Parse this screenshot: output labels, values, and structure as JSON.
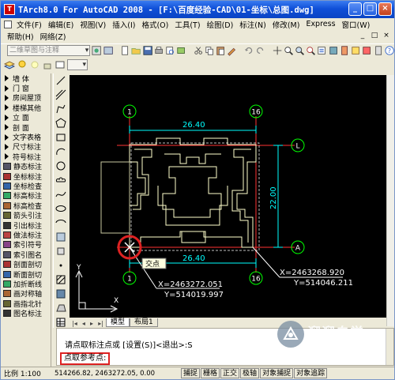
{
  "window": {
    "title": "TArch8.0 For AutoCAD 2008 - [F:\\百度经验-CAD\\01-坐标\\总图.dwg]",
    "app_icon_label": "T",
    "minimize": "_",
    "maximize": "□",
    "close": "×"
  },
  "menu": {
    "row1": [
      "文件(F)",
      "编辑(E)",
      "视图(V)",
      "插入(I)",
      "格式(O)",
      "工具(T)",
      "绘图(D)",
      "标注(N)",
      "修改(M)",
      "Express",
      "窗口(W)"
    ],
    "row2": [
      "帮助(H)",
      "网络(Z)"
    ],
    "mdi_buttons": [
      "_",
      "□",
      "×"
    ]
  },
  "toolbar": {
    "workspace_combo": "二维草图与注释"
  },
  "left_panel": {
    "items": [
      {
        "label": "墙    体",
        "sub": false
      },
      {
        "label": "门    窗",
        "sub": false
      },
      {
        "label": "房间屋顶",
        "sub": false
      },
      {
        "label": "楼梯其他",
        "sub": false
      },
      {
        "label": "立    面",
        "sub": false
      },
      {
        "label": "剖    面",
        "sub": false
      },
      {
        "label": "文字表格",
        "sub": false
      },
      {
        "label": "尺寸标注",
        "sub": false
      },
      {
        "label": "符号标注",
        "sub": false
      },
      {
        "label": "静态标注",
        "sub": true
      },
      {
        "label": "坐标标注",
        "sub": true
      },
      {
        "label": "坐标检查",
        "sub": true
      },
      {
        "label": "标高标注",
        "sub": true
      },
      {
        "label": "标高检查",
        "sub": true
      },
      {
        "label": "箭头引注",
        "sub": true
      },
      {
        "label": "引出标注",
        "sub": true
      },
      {
        "label": "做法标注",
        "sub": true
      },
      {
        "label": "索引符号",
        "sub": true
      },
      {
        "label": "索引图名",
        "sub": true
      },
      {
        "label": "剖面剖切",
        "sub": true
      },
      {
        "label": "断面剖切",
        "sub": true
      },
      {
        "label": "加折断线",
        "sub": true
      },
      {
        "label": "画对称轴",
        "sub": true
      },
      {
        "label": "画指北针",
        "sub": true
      },
      {
        "label": "图名标注",
        "sub": true
      }
    ]
  },
  "drawing": {
    "dim_top": "26.40",
    "dim_bottom": "26.40",
    "dim_right": "22.00",
    "axis_1_top": "1",
    "axis_16_top": "16",
    "axis_1_bottom": "1",
    "axis_16_bottom": "16",
    "axis_L": "L",
    "axis_A": "A",
    "coord_left_x": "X=2463272.051",
    "coord_left_y": "Y=514019.997",
    "coord_right_x": "X=2463268.920",
    "coord_right_y": "Y=514046.211",
    "ucs_y": "Y",
    "ucs_x": "X",
    "snap_tooltip": "交点"
  },
  "tabs": {
    "model": "模型",
    "layout1": "布局1",
    "arrows": [
      "|◂",
      "◂",
      "▸",
      "▸|"
    ]
  },
  "command": {
    "line1": "请点取标注点或 [设置(S)]<退出>:S",
    "line2": "点取参考点:"
  },
  "status": {
    "scale": "比例 1:100",
    "coords": "514266.82, 2463272.05, 0.00",
    "buttons": [
      "捕捉",
      "栅格",
      "正交",
      "极轴",
      "对象捕捉",
      "对象追踪"
    ]
  },
  "watermark": {
    "text": "溜溜自学",
    "url": "ZIXUE.3D66.COM"
  },
  "colors": {
    "axis_circle": "#00ff00",
    "dimension": "#00ffff",
    "building": "#ffffcc",
    "axis_line": "#ff3333",
    "highlight": "#dd2222"
  }
}
